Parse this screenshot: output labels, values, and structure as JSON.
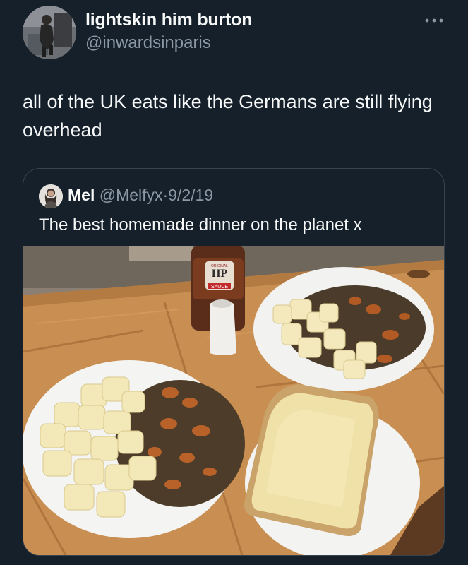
{
  "author": {
    "name": "lightskin him burton",
    "handle": "@inwardsinparis",
    "avatar_icon": "user-avatar-photo"
  },
  "more_menu": {
    "icon": "more-horizontal-icon"
  },
  "tweet": {
    "text": "all of the UK eats like the Germans are still flying overhead"
  },
  "quoted": {
    "name": "Mel",
    "handle": "@Melfyx",
    "separator": "·",
    "date": "9/2/19",
    "text": "The best homemade dinner on the planet x",
    "avatar_icon": "user-avatar-photo",
    "photo": {
      "bottle_brand": "HP",
      "bottle_label_top": "ORIGINAL",
      "bottle_label_bottom": "SAUCE"
    }
  },
  "colors": {
    "background": "#15202b",
    "text_primary": "#f7f9f9",
    "text_secondary": "#8b98a5",
    "border": "#38444d"
  }
}
